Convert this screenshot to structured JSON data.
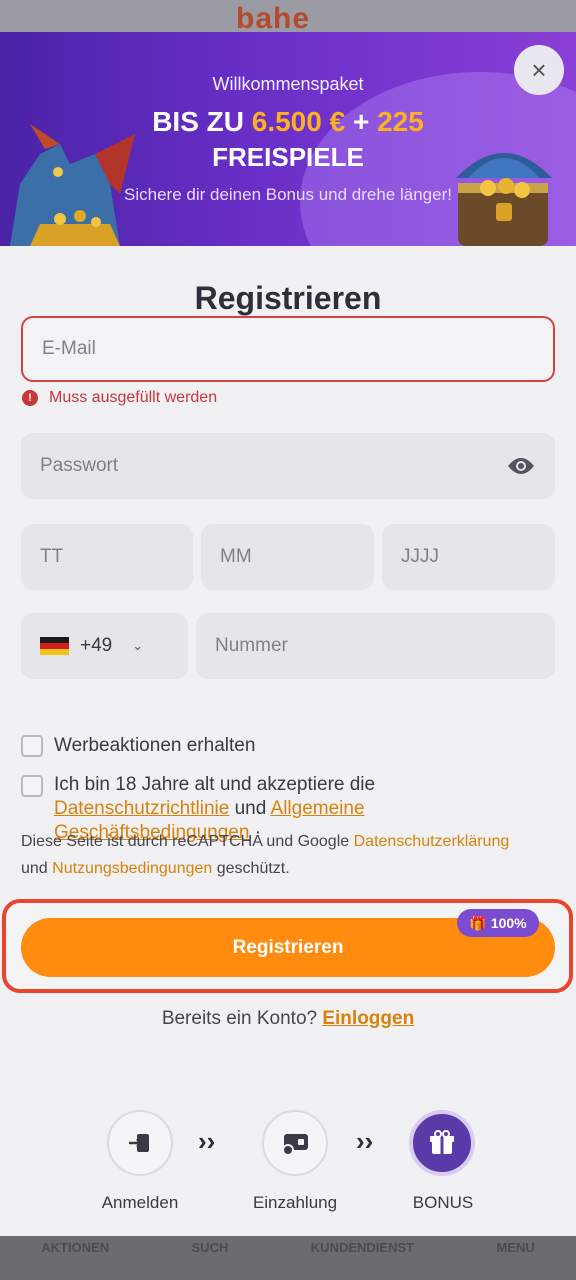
{
  "background": {
    "logo_text": "bahe",
    "bottom_nav": [
      "AKTIONEN",
      "SUCH",
      "KUNDENDIENST",
      "MENU"
    ]
  },
  "banner": {
    "subtitle": "Willkommenspaket",
    "headline_prefix": "BIS ZU",
    "headline_amount": "6.500 €",
    "headline_plus": "+",
    "headline_spins": "225",
    "headline_line2": "FREISPIELE",
    "description": "Sichere dir deinen Bonus und drehe länger!",
    "close_label": "×"
  },
  "form": {
    "title": "Registrieren",
    "email_placeholder": "E-Mail",
    "email_error": "Muss ausgefüllt werden",
    "password_placeholder": "Passwort",
    "day_placeholder": "TT",
    "month_placeholder": "MM",
    "year_placeholder": "JJJJ",
    "country_code": "+49",
    "phone_placeholder": "Nummer",
    "promo_checkbox_label": "Werbeaktionen erhalten",
    "terms_text_1": "Ich bin 18 Jahre alt und akzeptiere die",
    "privacy_link": "Datenschutzrichtlinie",
    "terms_and": "und",
    "terms_link_1": "Allgemeine",
    "terms_link_2": "Geschäftsbedingungen",
    "terms_end": "·",
    "recaptcha_1": "Diese Seite ist durch reCAPTCHA und Google",
    "recaptcha_privacy_link": "Datenschutzerklärung",
    "recaptcha_and": "und",
    "recaptcha_terms_link": "Nutzungsbedingungen",
    "recaptcha_end": "geschützt.",
    "submit_label": "Registrieren",
    "bonus_badge": "100%",
    "already_text": "Bereits ein Konto?",
    "login_link": "Einloggen"
  },
  "steps": [
    {
      "label": "Anmelden"
    },
    {
      "label": "Einzahlung"
    },
    {
      "label": "BONUS"
    }
  ],
  "colors": {
    "accent": "#ff8c0e",
    "error": "#c9373a",
    "purple": "#5a3aa8",
    "link": "#d8820c"
  }
}
